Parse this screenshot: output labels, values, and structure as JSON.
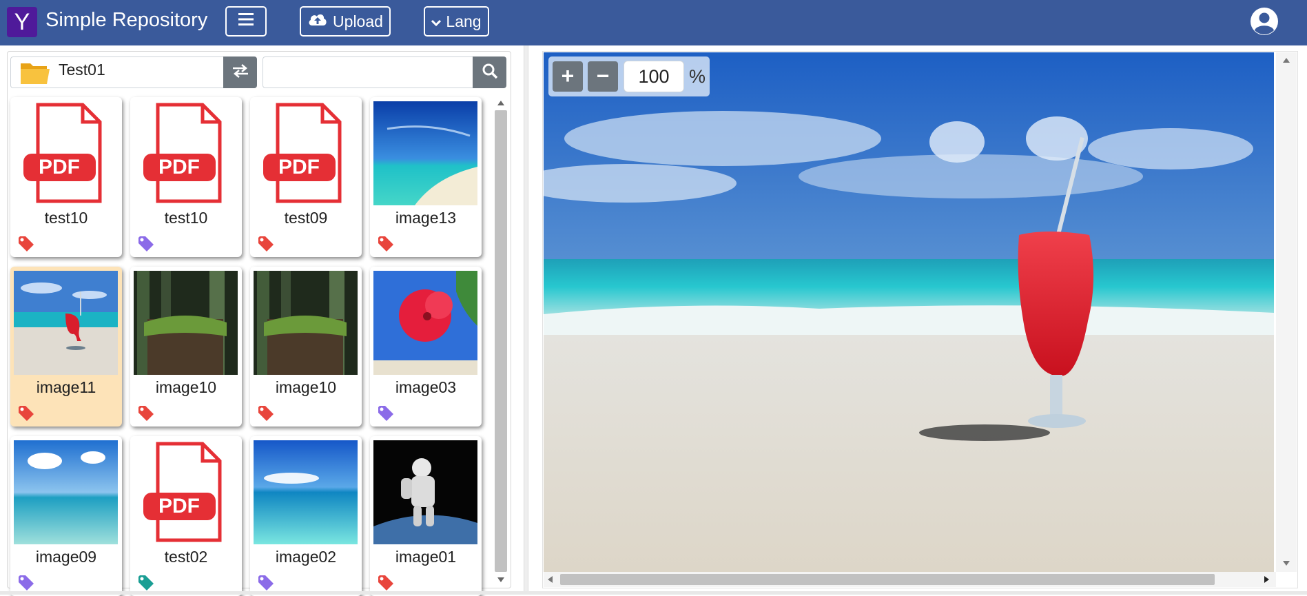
{
  "header": {
    "logo_letter": "Y",
    "brand": "Simple Repository",
    "menu_icon": "hamburger-icon",
    "upload_label": "Upload",
    "upload_icon": "cloud-upload-icon",
    "lang_label": "Lang",
    "lang_icon": "chevron-down-icon",
    "user_icon": "user-circle-icon",
    "bg_color": "#3a5a9b"
  },
  "browser": {
    "folder_name": "Test01",
    "folder_icon": "folder-icon",
    "swap_icon": "swap-icon",
    "search_value": "",
    "search_icon": "search-icon",
    "files": [
      {
        "name": "test10",
        "type": "pdf",
        "tag_color": "#e8453c"
      },
      {
        "name": "test10",
        "type": "pdf",
        "tag_color": "#8b6be8"
      },
      {
        "name": "test09",
        "type": "pdf",
        "tag_color": "#e8453c"
      },
      {
        "name": "image13",
        "type": "image",
        "tag_color": "#e8453c"
      },
      {
        "name": "image11",
        "type": "image",
        "tag_color": "#e8453c",
        "selected": true
      },
      {
        "name": "image10",
        "type": "image",
        "tag_color": "#e8453c"
      },
      {
        "name": "image10",
        "type": "image",
        "tag_color": "#e8453c"
      },
      {
        "name": "image03",
        "type": "image",
        "tag_color": "#8b6be8"
      },
      {
        "name": "image09",
        "type": "image",
        "tag_color": "#8b6be8"
      },
      {
        "name": "test02",
        "type": "pdf",
        "tag_color": "#1a9e94"
      },
      {
        "name": "image02",
        "type": "image",
        "tag_color": "#8b6be8"
      },
      {
        "name": "image01",
        "type": "image",
        "tag_color": "#e8453c"
      }
    ]
  },
  "viewer": {
    "zoom_in_label": "+",
    "zoom_out_label": "−",
    "zoom_value": "100",
    "zoom_unit": "%"
  }
}
